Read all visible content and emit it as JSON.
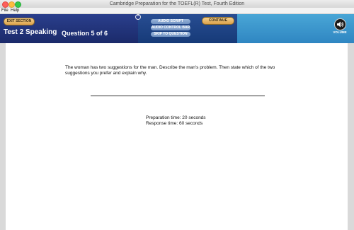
{
  "window": {
    "title": "Cambridge Preparation for the TOEFL(R) Test, Fourth Edition"
  },
  "menu": {
    "file": "File",
    "help": "Help"
  },
  "header": {
    "exit_label": "EXIT SECTION",
    "section_title": "Test 2 Speaking",
    "question_label": "Question 5 of 6",
    "continue_label": "CONTINUE",
    "audio_script_label": "AUDIO SCRIPT",
    "audio_control_label": "AUDIO CONTROL BAR",
    "skip_label": "SKIP TO QUESTION",
    "volume_label": "VOLUME",
    "toggle_glyph": "^"
  },
  "content": {
    "prompt": "The woman has two suggestions for the man. Describe the man's problem. Then state which of the two suggestions you prefer and explain why.",
    "preparation_time": "Preparation time: 20 seconds",
    "response_time": "Response time: 60 seconds"
  },
  "colors": {
    "header_dark": "#1b2a6a",
    "header_light": "#2f86c2",
    "button_gold": "#dca24a"
  }
}
